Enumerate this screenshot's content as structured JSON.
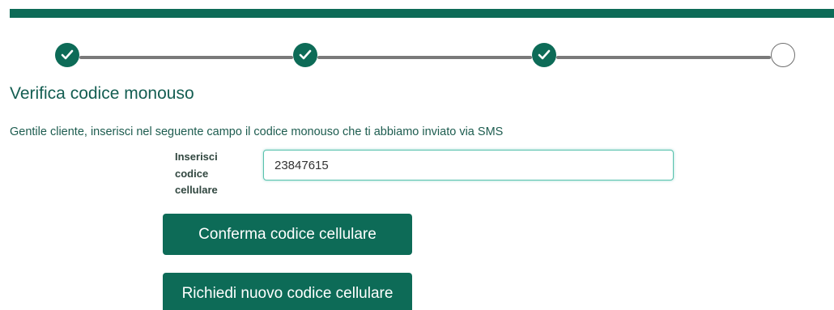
{
  "colors": {
    "brand": "#0d6b57",
    "title": "#145e52",
    "connector": "#7a7a7a",
    "input_border": "#59c2ae"
  },
  "stepper": {
    "steps": [
      {
        "status": "completed",
        "icon": "checkmark-icon"
      },
      {
        "status": "completed",
        "icon": "checkmark-icon"
      },
      {
        "status": "completed",
        "icon": "checkmark-icon"
      },
      {
        "status": "pending",
        "icon": ""
      }
    ]
  },
  "page": {
    "title": "Verifica codice monouso",
    "instruction": "Gentile cliente, inserisci nel seguente campo il codice monouso che ti abbiamo inviato via SMS"
  },
  "form": {
    "code_label": "Inserisci codice cellulare",
    "code_value": "23847615"
  },
  "actions": {
    "confirm_label": "Conferma codice cellulare",
    "resend_label": "Richiedi nuovo codice cellulare"
  }
}
